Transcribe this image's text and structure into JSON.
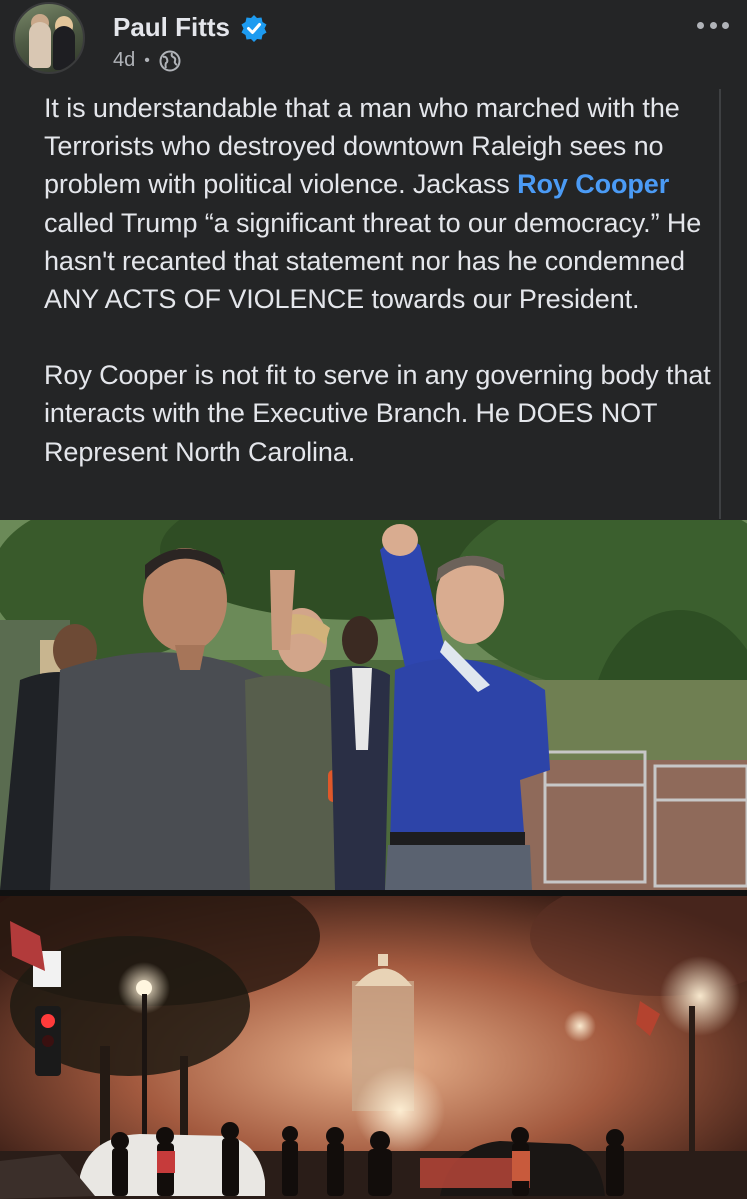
{
  "post": {
    "author": "Paul Fitts",
    "time": "4d",
    "separator": "•",
    "privacy_icon": "globe-icon",
    "verified_icon": "verified-badge-icon",
    "more_icon": "more-options-icon",
    "text": {
      "p1_before_mention": "It is understandable that a man who marched with the Terrorists who destroyed downtown Raleigh sees no problem with political violence. Jackass",
      "mention": "Roy Cooper",
      "p1_after_mention": "called Trump “a significant threat to our democracy.” He hasn't recanted that statement nor has he condemned ANY ACTS OF VIOLENCE towards our President.",
      "p2": "Roy Cooper is not fit to serve in any governing body that interacts with the Executive Branch. He DOES NOT Represent North Carolina."
    },
    "images": [
      {
        "name": "march-photo"
      },
      {
        "name": "protest-night-photo"
      }
    ]
  },
  "colors": {
    "background": "#242526",
    "text": "#e4e6eb",
    "secondary_text": "#b0b3b8",
    "mention": "#4b9bf5",
    "verified": "#1d9bf0"
  }
}
